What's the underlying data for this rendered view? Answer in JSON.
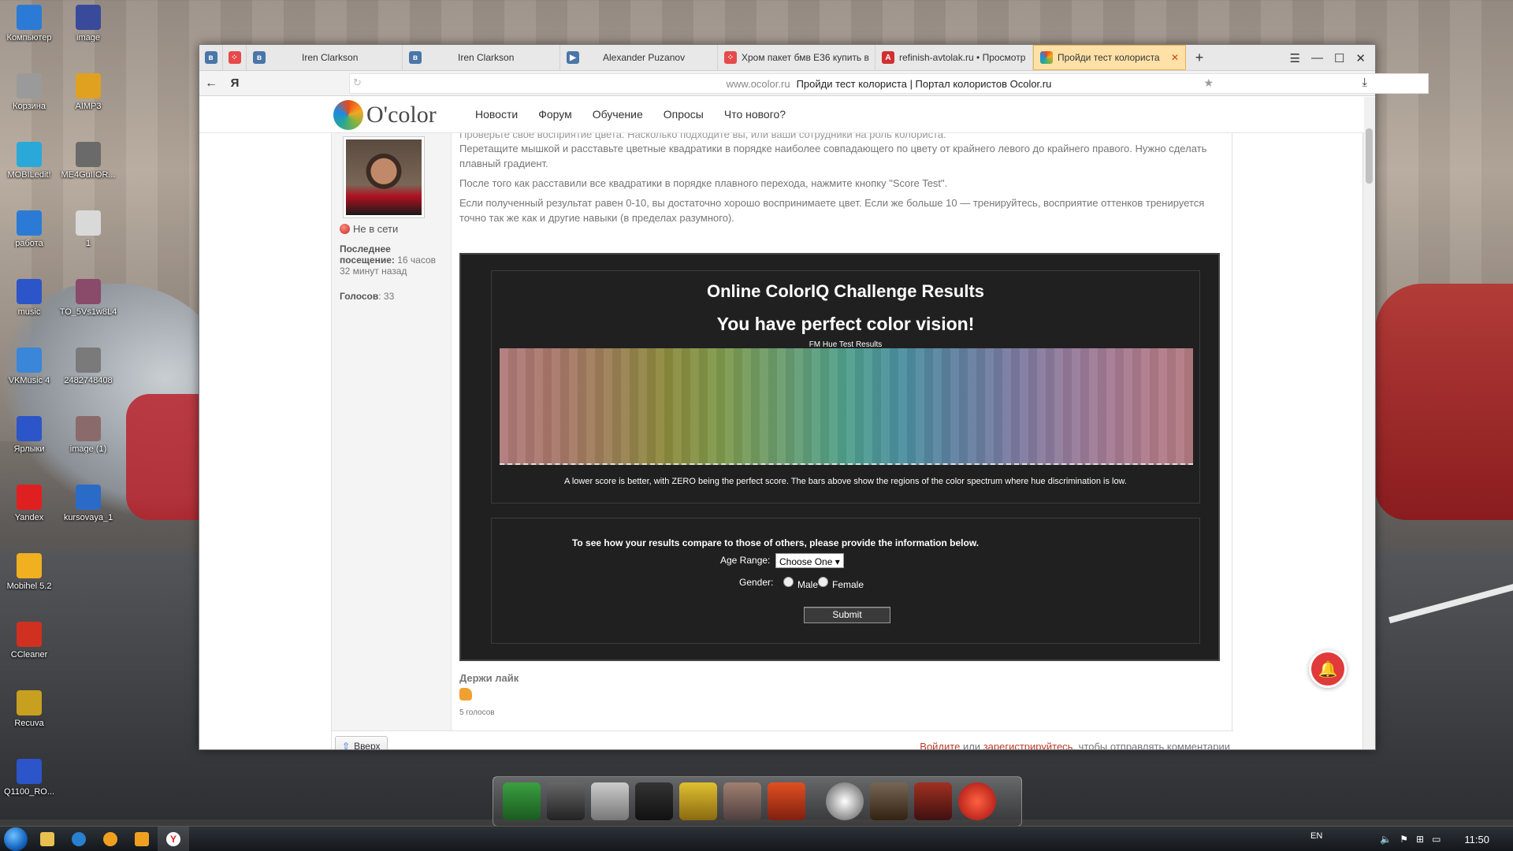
{
  "desktop": {
    "icons": [
      {
        "label": "Компьютер",
        "color": "#2b7bd6"
      },
      {
        "label": "image",
        "color": "#3a4a9a"
      },
      {
        "label": "Корзина",
        "color": "#9a9a9a"
      },
      {
        "label": "AIMP3",
        "color": "#e0a020"
      },
      {
        "label": "MOBILedit!",
        "color": "#2aa9d8"
      },
      {
        "label": "ME4GuIIOR...",
        "color": "#6a6a6a"
      },
      {
        "label": "работа",
        "color": "#2b7bd6"
      },
      {
        "label": "1",
        "color": "#d9d9d9"
      },
      {
        "label": "music",
        "color": "#2b55c8"
      },
      {
        "label": "TO_5Vs1w8L4",
        "color": "#8a4a6a"
      },
      {
        "label": "VKMusic 4",
        "color": "#3a86d8"
      },
      {
        "label": "2482748408",
        "color": "#7a7a7a"
      },
      {
        "label": "Ярлыки",
        "color": "#2b55c8"
      },
      {
        "label": "image (1)",
        "color": "#8a6a6a"
      },
      {
        "label": "Yandex",
        "color": "#e02020"
      },
      {
        "label": "kursovaya_1",
        "color": "#2b6bc8"
      },
      {
        "label": "Mobihel 5.2",
        "color": "#f0b020"
      },
      {
        "label": "CCleaner",
        "color": "#d03020"
      },
      {
        "label": "Recuva",
        "color": "#c8a020"
      },
      {
        "label": "Q1100_RO...",
        "color": "#2b55c8"
      }
    ]
  },
  "browser": {
    "tabs": [
      {
        "label": "",
        "icon": "vk-icon",
        "color": "#4a76a8"
      },
      {
        "label": "",
        "icon": "dots-icon",
        "color": "#e64a4a"
      },
      {
        "label": "Iren Clarkson",
        "icon": "vk-icon",
        "color": "#4a76a8"
      },
      {
        "label": "Iren Clarkson",
        "icon": "vk-icon",
        "color": "#4a76a8"
      },
      {
        "label": "Alexander Puzanov",
        "icon": "video-icon",
        "color": "#4a76a8"
      },
      {
        "label": "Хром пакет бмв Е36 купить в",
        "icon": "dots-icon",
        "color": "#e64a4a"
      },
      {
        "label": "refinish-avtolak.ru • Просмотр",
        "icon": "a-icon",
        "color": "#d03030"
      },
      {
        "label": "Пройди тест колориста",
        "icon": "ocolor-icon",
        "color": "#f0a020",
        "active": true
      }
    ],
    "new_tab": "+",
    "url_host": "www.ocolor.ru",
    "url_title": "Пройди тест колориста | Портал колористов Ocolor.ru"
  },
  "site": {
    "logo": "O'color",
    "nav": [
      "Новости",
      "Форум",
      "Обучение",
      "Опросы",
      "Что нового?"
    ],
    "user": {
      "status": "Не в сети",
      "last_seen_label": "Последнее посещение:",
      "last_seen_value": "16 часов 32 минут назад",
      "votes_label": "Голосов",
      "votes_value": ": 33"
    },
    "intro_hidden": "Проверьте свое восприятие цвета. Насколько подходите вы, или ваши сотрудники на роль колориста.",
    "p1": "Перетащите мышкой и расставьте цветные квадратики в порядке наиболее совпадающего по цвету от крайнего левого до крайнего правого. Нужно сделать плавный градиент.",
    "p2": "После того как расставили все квадратики в порядке плавного перехода, нажмите кнопку \"Score Test\".",
    "p3": "Если полученный результат равен 0-10, вы достаточно хорошо воспринимаете цвет. Если же больше 10 — тренируйтесь, восприятие оттенков тренируется точно так же как и другие навыки (в пределах разумного).",
    "result": {
      "title": "Online ColorIQ Challenge Results",
      "subtitle": "You have perfect color vision!",
      "chart_title": "FM Hue Test Results",
      "note": "A lower score is better, with ZERO being the perfect score. The bars above show the regions of the color spectrum where hue discrimination is low.",
      "compare": "To see how your results compare to those of others, please provide the information below.",
      "age_label": "Age Range:",
      "age_value": "Choose One",
      "gender_label": "Gender:",
      "male": "Male",
      "female": "Female",
      "submit": "Submit"
    },
    "like_title": "Держи лайк",
    "like_votes": "5 голосов",
    "up_button": "Вверх",
    "login_text_1": "Войдите",
    "login_text_2": " или ",
    "login_text_3": "зарегистрируйтесь",
    "login_text_4": ", чтобы отправлять комментарии"
  },
  "taskbar": {
    "lang": "EN",
    "time": "11:50"
  }
}
